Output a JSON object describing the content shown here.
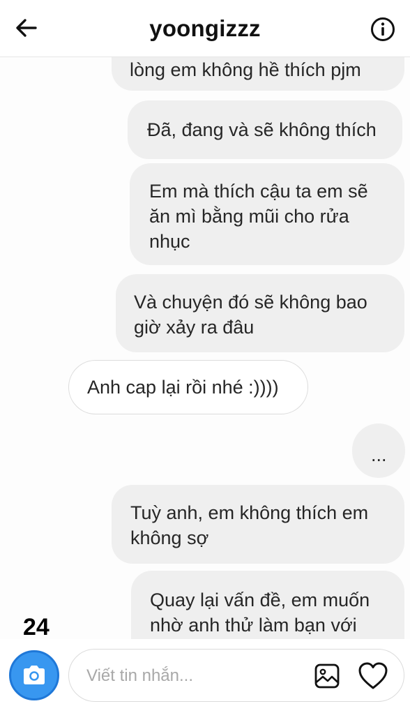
{
  "header": {
    "title": "yoongizzz",
    "back_icon": "arrow-left-icon",
    "info_icon": "info-circle-icon"
  },
  "messages": [
    {
      "from": "me",
      "text": "lòng em không hề thích pjm"
    },
    {
      "from": "me",
      "text": "Đã, đang và sẽ không thích"
    },
    {
      "from": "me",
      "text": "Em mà thích cậu ta em sẽ ăn mì bằng mũi cho rửa nhục"
    },
    {
      "from": "me",
      "text": "Và chuyện đó sẽ không bao giờ xảy ra đâu"
    },
    {
      "from": "them",
      "text": "Anh cap lại rồi nhé :))))"
    },
    {
      "from": "me",
      "text": "..."
    },
    {
      "from": "me",
      "text": "Tuỳ anh, em không thích em không sợ"
    },
    {
      "from": "me",
      "text": "Quay lại vấn đề, em muốn nhờ anh thử làm bạn với"
    }
  ],
  "page_number": "24",
  "composer": {
    "placeholder": "Viết tin nhắn...",
    "camera_icon": "camera-icon",
    "gallery_icon": "image-icon",
    "like_icon": "heart-icon"
  },
  "colors": {
    "own_bubble": "#efefef",
    "camera_button": "#3897f0",
    "border": "#dbdbdb"
  }
}
